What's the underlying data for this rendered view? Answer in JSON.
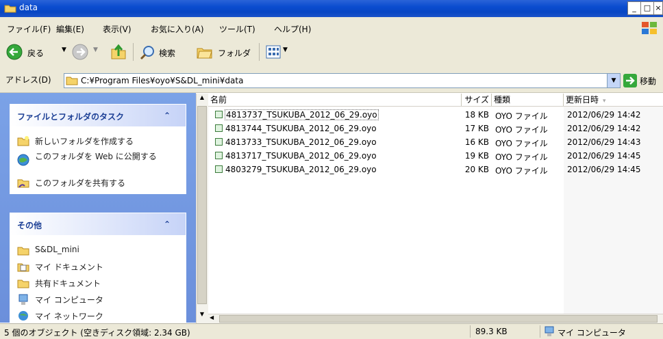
{
  "window": {
    "title": "data"
  },
  "menu": [
    "ファイル(F)",
    "編集(E)",
    "表示(V)",
    "お気に入り(A)",
    "ツール(T)",
    "ヘルプ(H)"
  ],
  "toolbar": {
    "back": "戻る",
    "search": "検索",
    "folders": "フォルダ"
  },
  "address": {
    "label": "アドレス(D)",
    "path": "C:¥Program Files¥oyo¥S&DL_mini¥data",
    "go": "移動"
  },
  "tasks_panel": {
    "title": "ファイルとフォルダのタスク",
    "items": [
      {
        "label": "新しいフォルダを作成する",
        "icon": "new-folder-icon"
      },
      {
        "label": "このフォルダを Web に公開する",
        "icon": "web-publish-icon"
      },
      {
        "label": "このフォルダを共有する",
        "icon": "share-folder-icon"
      }
    ]
  },
  "other_panel": {
    "title": "その他",
    "items": [
      {
        "label": "S&DL_mini",
        "icon": "folder-icon"
      },
      {
        "label": "マイ ドキュメント",
        "icon": "my-documents-icon"
      },
      {
        "label": "共有ドキュメント",
        "icon": "folder-icon"
      },
      {
        "label": "マイ コンピュータ",
        "icon": "my-computer-icon"
      },
      {
        "label": "マイ ネットワーク",
        "icon": "my-network-icon"
      }
    ]
  },
  "columns": {
    "name": "名前",
    "size": "サイズ",
    "type": "種類",
    "modified": "更新日時"
  },
  "files": [
    {
      "name": "4813737_TSUKUBA_2012_06_29.oyo",
      "size": "18 KB",
      "type": "OYO ファイル",
      "modified": "2012/06/29 14:42"
    },
    {
      "name": "4813744_TSUKUBA_2012_06_29.oyo",
      "size": "17 KB",
      "type": "OYO ファイル",
      "modified": "2012/06/29 14:42"
    },
    {
      "name": "4813733_TSUKUBA_2012_06_29.oyo",
      "size": "16 KB",
      "type": "OYO ファイル",
      "modified": "2012/06/29 14:43"
    },
    {
      "name": "4813717_TSUKUBA_2012_06_29.oyo",
      "size": "19 KB",
      "type": "OYO ファイル",
      "modified": "2012/06/29 14:45"
    },
    {
      "name": "4803279_TSUKUBA_2012_06_29.oyo",
      "size": "20 KB",
      "type": "OYO ファイル",
      "modified": "2012/06/29 14:45"
    }
  ],
  "status": {
    "objects": "5 個のオブジェクト (空きディスク領域: 2.34 GB)",
    "size": "89.3 KB",
    "location": "マイ コンピュータ"
  }
}
